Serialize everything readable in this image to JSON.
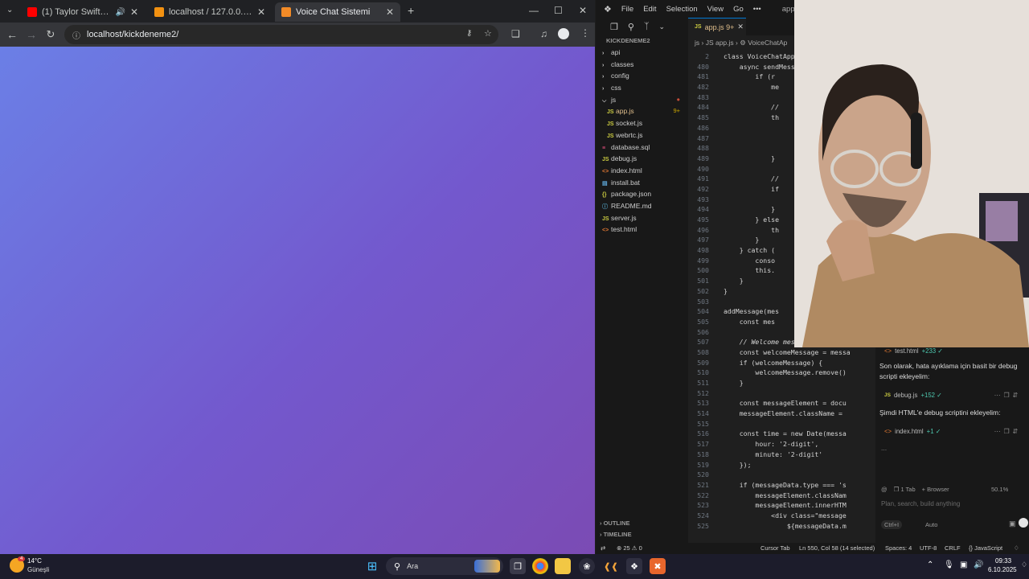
{
  "browser": {
    "tabs": [
      {
        "label": "(1) Taylor Swift - Wi$h Li$t (",
        "favicon": "youtube-icon",
        "color": "#ff0000",
        "audio": true
      },
      {
        "label": "localhost / 127.0.0.1 / voice_cha",
        "favicon": "phpmyadmin-icon",
        "color": "#f29111"
      },
      {
        "label": "Voice Chat Sistemi",
        "favicon": "page-icon",
        "color": "#f28b27",
        "active": true
      }
    ],
    "new_tab": "+",
    "url": "localhost/kickdeneme2/",
    "page_gradient": [
      "#6b7fe6",
      "#7358cd",
      "#7b4bb4"
    ]
  },
  "vscode": {
    "menu": [
      "File",
      "Edit",
      "Selection",
      "View",
      "Go",
      "•••"
    ],
    "window_title": "app.js - k",
    "explorer_title": "KICKDENEME2",
    "tree": [
      {
        "label": "api",
        "type": "folder"
      },
      {
        "label": "classes",
        "type": "folder"
      },
      {
        "label": "config",
        "type": "folder"
      },
      {
        "label": "css",
        "type": "folder"
      },
      {
        "label": "js",
        "type": "folder-open",
        "badge": "●"
      },
      {
        "label": "app.js",
        "type": "js",
        "indent": 1,
        "badge": "9+",
        "modified": true
      },
      {
        "label": "socket.js",
        "type": "js",
        "indent": 1
      },
      {
        "label": "webrtc.js",
        "type": "js",
        "indent": 1
      },
      {
        "label": "database.sql",
        "type": "db"
      },
      {
        "label": "debug.js",
        "type": "js"
      },
      {
        "label": "index.html",
        "type": "html"
      },
      {
        "label": "install.bat",
        "type": "bat"
      },
      {
        "label": "package.json",
        "type": "json"
      },
      {
        "label": "README.md",
        "type": "md"
      },
      {
        "label": "server.js",
        "type": "js"
      },
      {
        "label": "test.html",
        "type": "html"
      }
    ],
    "outline_label": "OUTLINE",
    "timeline_label": "TIMELINE",
    "editor_tab": "app.js 9+",
    "breadcrumb": "js › JS app.js › ⚙ VoiceChatAp",
    "code_lines": [
      {
        "n": "2",
        "t": "class VoiceChatApp"
      },
      {
        "n": "480",
        "t": "    async sendMess"
      },
      {
        "n": "481",
        "t": "        if (r"
      },
      {
        "n": "482",
        "t": "            me"
      },
      {
        "n": "483",
        "t": ""
      },
      {
        "n": "484",
        "t": "            //"
      },
      {
        "n": "485",
        "t": "            th"
      },
      {
        "n": "486",
        "t": ""
      },
      {
        "n": "487",
        "t": ""
      },
      {
        "n": "488",
        "t": ""
      },
      {
        "n": "489",
        "t": "            }"
      },
      {
        "n": "490",
        "t": ""
      },
      {
        "n": "491",
        "t": "            //"
      },
      {
        "n": "492",
        "t": "            if"
      },
      {
        "n": "493",
        "t": ""
      },
      {
        "n": "494",
        "t": "            }"
      },
      {
        "n": "495",
        "t": "        } else"
      },
      {
        "n": "496",
        "t": "            th"
      },
      {
        "n": "497",
        "t": "        }"
      },
      {
        "n": "498",
        "t": "    } catch ("
      },
      {
        "n": "499",
        "t": "        conso"
      },
      {
        "n": "500",
        "t": "        this."
      },
      {
        "n": "501",
        "t": "    }"
      },
      {
        "n": "502",
        "t": "}"
      },
      {
        "n": "503",
        "t": ""
      },
      {
        "n": "504",
        "t": "addMessage(mes"
      },
      {
        "n": "505",
        "t": "    const mes"
      },
      {
        "n": "506",
        "t": ""
      },
      {
        "n": "507",
        "t": "    // Welcome mesajını kaldır"
      },
      {
        "n": "508",
        "t": "    const welcomeMessage = messa"
      },
      {
        "n": "509",
        "t": "    if (welcomeMessage) {"
      },
      {
        "n": "510",
        "t": "        welcomeMessage.remove()"
      },
      {
        "n": "511",
        "t": "    }"
      },
      {
        "n": "512",
        "t": ""
      },
      {
        "n": "513",
        "t": "    const messageElement = docu"
      },
      {
        "n": "514",
        "t": "    messageElement.className ="
      },
      {
        "n": "515",
        "t": ""
      },
      {
        "n": "516",
        "t": "    const time = new Date(messa"
      },
      {
        "n": "517",
        "t": "        hour: '2-digit',"
      },
      {
        "n": "518",
        "t": "        minute: '2-digit'"
      },
      {
        "n": "519",
        "t": "    });"
      },
      {
        "n": "520",
        "t": ""
      },
      {
        "n": "521",
        "t": "    if (messageData.type === 's"
      },
      {
        "n": "522",
        "t": "        messageElement.classNam"
      },
      {
        "n": "523",
        "t": "        messageElement.innerHTM"
      },
      {
        "n": "524",
        "t": "            <div class=\"message"
      },
      {
        "n": "525",
        "t": "                ${messageData.m"
      }
    ],
    "status": {
      "left_icon": "remote-icon",
      "problems": "⊗ 25 ⚠ 0",
      "cursor_tab": "Cursor Tab",
      "position": "Ln 550, Col 58 (14 selected)",
      "spaces": "Spaces: 4",
      "encoding": "UTF-8",
      "eol": "CRLF",
      "language": "{} JavaScript"
    }
  },
  "chat": {
    "top_chip": {
      "file": "test.html",
      "delta": "+233 ✓"
    },
    "message1": "Son olarak, hata ayıklama için basit bir debug scripti ekleyelim:",
    "chip1": {
      "file": "debug.js",
      "delta": "+152 ✓"
    },
    "message2": "Şimdi HTML'e debug scriptini ekleyelim:",
    "chip2": {
      "file": "index.html",
      "delta": "+1 ✓"
    },
    "ellipsis": "...",
    "composer": {
      "tab_count": "1 Tab",
      "browser_label": "Browser",
      "zoom": "50.1%",
      "placeholder": "Plan, search, build anything",
      "mode": "Ctrl+I",
      "model": "Auto"
    }
  },
  "taskbar": {
    "weather_temp": "14°C",
    "weather_desc": "Güneşli",
    "weather_badge": "4",
    "search_placeholder": "Ara",
    "time": "09:33",
    "date": "6.10.2025"
  }
}
